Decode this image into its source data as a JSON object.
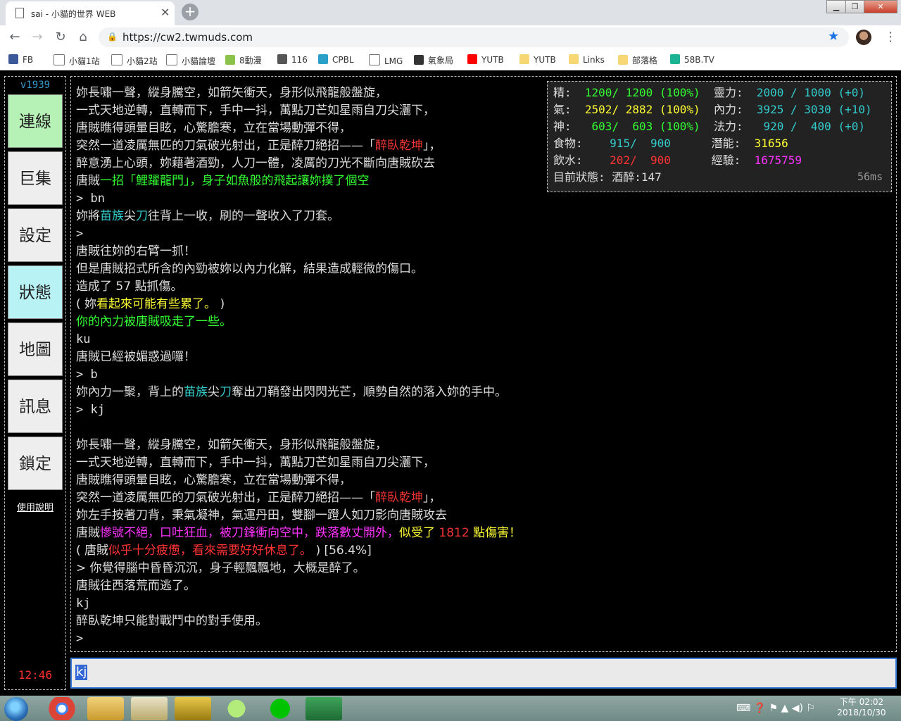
{
  "browser": {
    "tab_title": "sai - 小貓的世界 WEB",
    "tab_close": "✕",
    "new_tab": "+",
    "url": "https://cw2.twmuds.com",
    "bookmarks": [
      {
        "label": "FB",
        "icon": "facebook-icon",
        "color": "#3b5998"
      },
      {
        "label": "小貓1站",
        "icon": "page-icon",
        "color": "#ffffff"
      },
      {
        "label": "小貓2站",
        "icon": "page-icon",
        "color": "#ffffff"
      },
      {
        "label": "小貓論壇",
        "icon": "page-icon",
        "color": "#ffffff"
      },
      {
        "label": "8動漫",
        "icon": "leaf-icon",
        "color": "#8bc34a"
      },
      {
        "label": "116",
        "icon": "film-icon",
        "color": "#555555"
      },
      {
        "label": "CPBL",
        "icon": "cpbl-icon",
        "color": "#2aa0c8"
      },
      {
        "label": "LMG",
        "icon": "page-icon",
        "color": "#ffffff"
      },
      {
        "label": "氣象局",
        "icon": "eye-icon",
        "color": "#333333"
      },
      {
        "label": "YUTB",
        "icon": "youtube-icon",
        "color": "#ff0000"
      },
      {
        "label": "YUTB",
        "icon": "folder-icon",
        "color": "#f7d774"
      },
      {
        "label": "Links",
        "icon": "folder-icon",
        "color": "#f7d774"
      },
      {
        "label": "部落格",
        "icon": "folder-icon",
        "color": "#f7d774"
      },
      {
        "label": "58B.TV",
        "icon": "58-icon",
        "color": "#1ab394"
      }
    ]
  },
  "sidebar": {
    "version": "v1939",
    "buttons": [
      "連線",
      "巨集",
      "設定",
      "狀態",
      "地圖",
      "訊息",
      "鎖定"
    ],
    "help": "使用說明",
    "clock": "12:46"
  },
  "stats": {
    "rows": [
      [
        {
          "t": "精:  ",
          "c": "w"
        },
        {
          "t": "1200/ 1200 (100%)",
          "c": "g"
        },
        {
          "t": "  靈力:  ",
          "c": "w"
        },
        {
          "t": "2000 / 1000 (+0)",
          "c": "c"
        }
      ],
      [
        {
          "t": "氣:  ",
          "c": "w"
        },
        {
          "t": "2502/ 2882 (100%)",
          "c": "y"
        },
        {
          "t": "  內力:  ",
          "c": "w"
        },
        {
          "t": "3925 / 3030 (+10)",
          "c": "c"
        }
      ],
      [
        {
          "t": "神:  ",
          "c": "w"
        },
        {
          "t": " 603/  603 (100%)",
          "c": "g"
        },
        {
          "t": "  法力:  ",
          "c": "w"
        },
        {
          "t": " 920 /  400 (+0)",
          "c": "c"
        }
      ],
      [
        {
          "t": "食物:    ",
          "c": "w"
        },
        {
          "t": "915/  900",
          "c": "c"
        },
        {
          "t": "      潛能:  ",
          "c": "w"
        },
        {
          "t": "31656",
          "c": "y"
        }
      ],
      [
        {
          "t": "飲水:    ",
          "c": "w"
        },
        {
          "t": "202/  900",
          "c": "r"
        },
        {
          "t": "      經驗:  ",
          "c": "w"
        },
        {
          "t": "1675759",
          "c": "m"
        }
      ],
      [
        {
          "t": "目前狀態: 酒醉:147",
          "c": "w"
        }
      ]
    ],
    "ping": "56ms"
  },
  "log": [
    [
      {
        "t": "妳長嘯一聲，縱身騰空，如箭矢衝天，身形似飛龍般盤旋，",
        "c": "w"
      }
    ],
    [
      {
        "t": "一式天地逆轉，直轉而下，手中一抖，萬點刀芒如星雨自刀尖灑下，",
        "c": "w"
      }
    ],
    [
      {
        "t": "唐賊瞧得頭暈目眩，心驚膽寒，立在當場動彈不得，",
        "c": "w"
      }
    ],
    [
      {
        "t": "突然一道凌厲無匹的刀氣破光射出，正是醉刀絕招——「",
        "c": "w"
      },
      {
        "t": "醉臥乾坤",
        "c": "rd"
      },
      {
        "t": "」，",
        "c": "w"
      }
    ],
    [
      {
        "t": "醉意湧上心頭，妳藉著酒勁，人刀一體，凌厲的刀光不斷向唐賊砍去",
        "c": "w"
      }
    ],
    [
      {
        "t": "唐賊",
        "c": "w"
      },
      {
        "t": "一招「鯉躍龍門」，身子如魚般的飛起讓妳撲了個空",
        "c": "g"
      }
    ],
    [
      {
        "t": "> bn",
        "c": "w",
        "m": 1
      }
    ],
    [
      {
        "t": "妳將",
        "c": "w"
      },
      {
        "t": "苗族",
        "c": "c"
      },
      {
        "t": "尖",
        "c": "w"
      },
      {
        "t": "刀",
        "c": "c"
      },
      {
        "t": "往背上一收，刷的一聲收入了刀套。",
        "c": "w"
      }
    ],
    [
      {
        "t": ">",
        "c": "w",
        "m": 1
      }
    ],
    [
      {
        "t": "唐賊往妳的右臂一抓！",
        "c": "w"
      }
    ],
    [
      {
        "t": "但是唐賊招式所含的內勁被妳以內力化解，結果造成輕微的傷口。",
        "c": "w"
      }
    ],
    [
      {
        "t": "造成了 57 點抓傷。",
        "c": "w"
      }
    ],
    [
      {
        "t": "( 妳",
        "c": "w"
      },
      {
        "t": "看起來可能有些累了。",
        "c": "y"
      },
      {
        "t": " )",
        "c": "w"
      }
    ],
    [
      {
        "t": "你的內力被唐賊吸走了一些。",
        "c": "g"
      }
    ],
    [
      {
        "t": "ku",
        "c": "w",
        "m": 1
      }
    ],
    [
      {
        "t": "唐賊已經被媚惑過囉！",
        "c": "w"
      }
    ],
    [
      {
        "t": "> b",
        "c": "w",
        "m": 1
      }
    ],
    [
      {
        "t": "妳內力一聚，背上的",
        "c": "w"
      },
      {
        "t": "苗族",
        "c": "c"
      },
      {
        "t": "尖",
        "c": "w"
      },
      {
        "t": "刀",
        "c": "c"
      },
      {
        "t": "奪出刀鞘發出閃閃光芒，順勢自然的落入妳的手中。",
        "c": "w"
      }
    ],
    [
      {
        "t": "> kj",
        "c": "w",
        "m": 1
      }
    ],
    [
      {
        "t": "",
        "c": "w"
      }
    ],
    [
      {
        "t": "妳長嘯一聲，縱身騰空，如箭矢衝天，身形似飛龍般盤旋，",
        "c": "w"
      }
    ],
    [
      {
        "t": "一式天地逆轉，直轉而下，手中一抖，萬點刀芒如星雨自刀尖灑下，",
        "c": "w"
      }
    ],
    [
      {
        "t": "唐賊瞧得頭暈目眩，心驚膽寒，立在當場動彈不得，",
        "c": "w"
      }
    ],
    [
      {
        "t": "突然一道凌厲無匹的刀氣破光射出，正是醉刀絕招——「",
        "c": "w"
      },
      {
        "t": "醉臥乾坤",
        "c": "rd"
      },
      {
        "t": "」，",
        "c": "w"
      }
    ],
    [
      {
        "t": "妳左手按著刀背，秉氣凝神，氣運丹田，雙腳一蹬人如刀影向唐賊攻去",
        "c": "w"
      }
    ],
    [
      {
        "t": "唐賊",
        "c": "w"
      },
      {
        "t": "慘號不絕，口吐狂血，被刀鋒衝向空中，跌落數丈開外，",
        "c": "m"
      },
      {
        "t": "似受了 ",
        "c": "y"
      },
      {
        "t": "1812",
        "c": "rd"
      },
      {
        "t": " 點傷害！",
        "c": "y"
      }
    ],
    [
      {
        "t": "( 唐賊",
        "c": "w"
      },
      {
        "t": "似乎十分疲憊，看來需要好好休息了。",
        "c": "r"
      },
      {
        "t": " ) [56.4%]",
        "c": "w"
      }
    ],
    [
      {
        "t": "> 你覺得腦中昏昏沉沉，身子輕飄飄地，大概是醉了。",
        "c": "w"
      }
    ],
    [
      {
        "t": "唐賊往西落荒而逃了。",
        "c": "w"
      }
    ],
    [
      {
        "t": "kj",
        "c": "w",
        "m": 1
      }
    ],
    [
      {
        "t": "醉臥乾坤只能對戰鬥中的對手使用。",
        "c": "w"
      }
    ],
    [
      {
        "t": ">",
        "c": "w",
        "m": 1
      }
    ]
  ],
  "input": {
    "value": "kj"
  },
  "taskbar": {
    "apps": [
      "chrome",
      "explorer",
      "mud-client",
      "winamp",
      "media",
      "line",
      "excel"
    ],
    "clock_time": "下午 02:02",
    "clock_date": "2018/10/30"
  }
}
